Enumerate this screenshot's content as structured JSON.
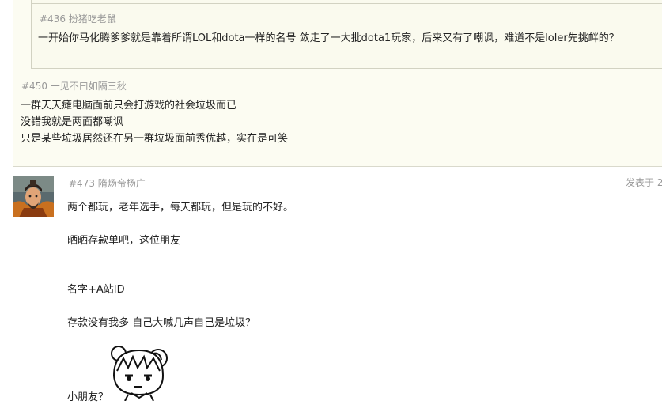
{
  "quote_outer": {
    "header": "#450 一见不曰如隔三秋",
    "lines": [
      "一群天天瘫电脑面前只会打游戏的社会垃圾而已",
      "没错我就是两面都嘲讽",
      "只是某些垃圾居然还在另一群垃圾面前秀优越，实在是可笑"
    ]
  },
  "quote_inner": {
    "header": "#436 扮猪吃老鼠",
    "text": "一开始你马化腾爹爹就是靠着所谓LOL和dota一样的名号  敛走了一大批dota1玩家，后来又有了嘲讽，难道不是loler先挑衅的？"
  },
  "post": {
    "header": "#473 隋炀帝杨广",
    "posted_at": "发表于 2",
    "lines": [
      "两个都玩，老年选手，每天都玩，但是玩的不好。",
      "晒晒存款单吧，这位朋友",
      "名字+A站ID",
      "存款没有我多  自己大喊几声自己是垃圾？",
      "小朋友？"
    ]
  },
  "icons": {
    "avatar": "general-portrait-avatar",
    "emoticon": "chibi-girl-emoticon"
  }
}
